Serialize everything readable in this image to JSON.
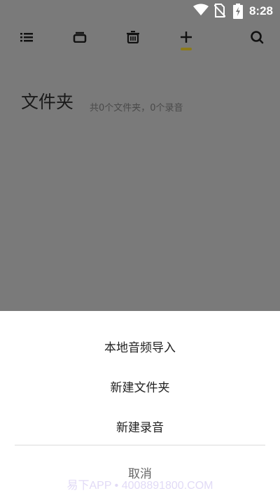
{
  "status_bar": {
    "time": "8:28",
    "icons": [
      "wifi-icon",
      "no-sim-icon",
      "battery-charging-icon"
    ]
  },
  "toolbar": {
    "icons": [
      "list-icon",
      "folder-icon",
      "trash-icon",
      "add-icon",
      "search-icon"
    ],
    "indicator_color": "#8c7a1a"
  },
  "page": {
    "title": "文件夹",
    "count_text": "共0个文件夹，0个录音"
  },
  "sheet": {
    "items": [
      {
        "label": "本地音频导入"
      },
      {
        "label": "新建文件夹"
      },
      {
        "label": "新建录音"
      }
    ],
    "cancel_label": "取消"
  },
  "watermark": "易下APP • 4008891800.COM",
  "colors": {
    "overlay": "#7a7a7a",
    "sheet_bg": "#ffffff"
  }
}
